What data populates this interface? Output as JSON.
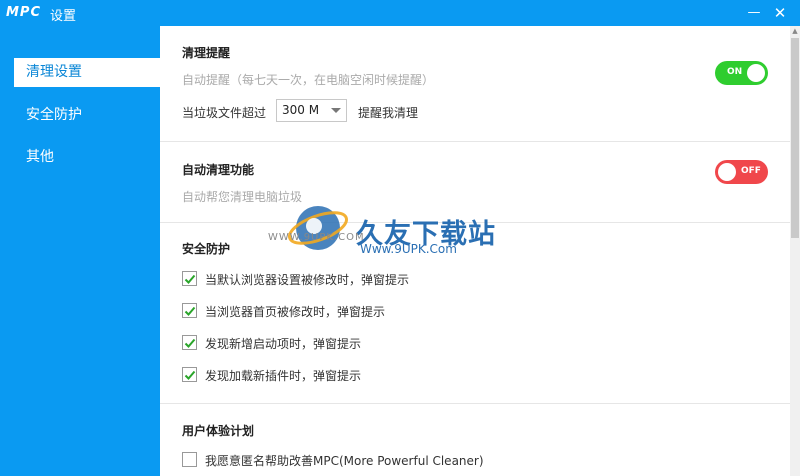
{
  "window": {
    "logo": "MPC",
    "title": "设置",
    "minimize": "—",
    "close": "✕"
  },
  "sidebar": {
    "items": [
      {
        "label": "清理设置",
        "active": true
      },
      {
        "label": "安全防护",
        "active": false
      },
      {
        "label": "其他",
        "active": false
      }
    ]
  },
  "sections": {
    "reminder": {
      "title": "清理提醒",
      "hint": "自动提醒（每七天一次，在电脑空闲时候提醒）",
      "threshold_prefix": "当垃圾文件超过",
      "threshold_value": "300 M",
      "threshold_suffix": "提醒我清理",
      "toggle_label": "ON",
      "toggle_on": true
    },
    "auto_clean": {
      "title": "自动清理功能",
      "hint": "自动帮您清理电脑垃圾",
      "toggle_label": "OFF",
      "toggle_on": false
    },
    "security": {
      "title": "安全防护",
      "checks": [
        {
          "label": "当默认浏览器设置被修改时，弹窗提示",
          "checked": true
        },
        {
          "label": "当浏览器首页被修改时，弹窗提示",
          "checked": true
        },
        {
          "label": "发现新增启动项时，弹窗提示",
          "checked": true
        },
        {
          "label": "发现加载新插件时，弹窗提示",
          "checked": true
        }
      ]
    },
    "ux": {
      "title": "用户体验计划",
      "checks": [
        {
          "label": "我愿意匿名帮助改善MPC(More Powerful Cleaner)",
          "checked": false
        }
      ]
    }
  },
  "watermark": {
    "brand": "久友下载站",
    "url": "Www.9UPK.Com",
    "www": "WWW.9UPK.COM"
  },
  "colors": {
    "accent": "#0a9af2",
    "toggle_on": "#2fcd2f",
    "toggle_off": "#f0474b",
    "check": "#2aa52a"
  }
}
